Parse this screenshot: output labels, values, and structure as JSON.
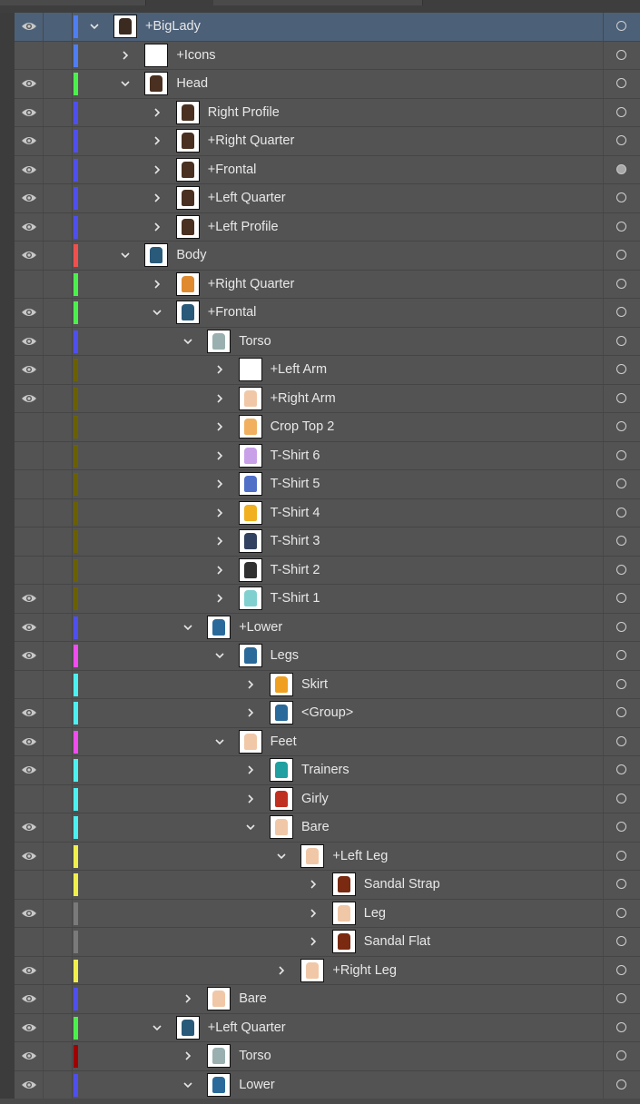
{
  "panel": "Layers",
  "colors": {
    "row_bg": "#535353",
    "selected_bg": "#4c6078",
    "blue": "#4f7ef2",
    "green": "#4cf04c",
    "violet": "#4f4ff0",
    "red": "#f0504c",
    "olive": "#6b6000",
    "magenta": "#f04cf0",
    "cyan": "#4cf0f0",
    "yellow": "#f0f04c",
    "gray": "#7a7a7a",
    "darkred": "#a00000"
  },
  "layers": [
    {
      "label": "+BigLady",
      "level": 0,
      "visible": true,
      "color": "blue",
      "expanded": true,
      "selected": true,
      "thumb": "#3a2a20"
    },
    {
      "label": "+Icons",
      "level": 1,
      "visible": false,
      "color": "blue",
      "expanded": false,
      "thumb": "#ffffff"
    },
    {
      "label": "Head",
      "level": 1,
      "visible": true,
      "color": "green",
      "expanded": true,
      "thumb": "#4a3020"
    },
    {
      "label": "Right Profile",
      "level": 2,
      "visible": true,
      "color": "violet",
      "expanded": false,
      "thumb": "#4a3020"
    },
    {
      "label": "+Right Quarter",
      "level": 2,
      "visible": true,
      "color": "violet",
      "expanded": false,
      "thumb": "#4a3020"
    },
    {
      "label": "+Frontal",
      "level": 2,
      "visible": true,
      "color": "violet",
      "expanded": false,
      "thumb": "#4a3020",
      "targeted": true
    },
    {
      "label": "+Left Quarter",
      "level": 2,
      "visible": true,
      "color": "violet",
      "expanded": false,
      "thumb": "#4a3020"
    },
    {
      "label": "+Left Profile",
      "level": 2,
      "visible": true,
      "color": "violet",
      "expanded": false,
      "thumb": "#4a3020"
    },
    {
      "label": "Body",
      "level": 1,
      "visible": true,
      "color": "red",
      "expanded": true,
      "thumb": "#2a5a7a"
    },
    {
      "label": "+Right Quarter",
      "level": 2,
      "visible": false,
      "color": "green",
      "expanded": false,
      "thumb": "#e08a30"
    },
    {
      "label": "+Frontal",
      "level": 2,
      "visible": true,
      "color": "green",
      "expanded": true,
      "thumb": "#2a5a7a"
    },
    {
      "label": "Torso",
      "level": 3,
      "visible": true,
      "color": "violet",
      "expanded": true,
      "thumb": "#9ab0b0"
    },
    {
      "label": "+Left Arm",
      "level": 4,
      "visible": true,
      "color": "olive",
      "expanded": false,
      "thumb": "#ffffff"
    },
    {
      "label": "+Right Arm",
      "level": 4,
      "visible": true,
      "color": "olive",
      "expanded": false,
      "thumb": "#f0c8a8"
    },
    {
      "label": "Crop Top 2",
      "level": 4,
      "visible": false,
      "color": "olive",
      "expanded": false,
      "thumb": "#f0b060"
    },
    {
      "label": "T-Shirt 6",
      "level": 4,
      "visible": false,
      "color": "olive",
      "expanded": false,
      "thumb": "#c8a0e8"
    },
    {
      "label": "T-Shirt 5",
      "level": 4,
      "visible": false,
      "color": "olive",
      "expanded": false,
      "thumb": "#5070c8"
    },
    {
      "label": "T-Shirt 4",
      "level": 4,
      "visible": false,
      "color": "olive",
      "expanded": false,
      "thumb": "#f0b020"
    },
    {
      "label": "T-Shirt 3",
      "level": 4,
      "visible": false,
      "color": "olive",
      "expanded": false,
      "thumb": "#304060"
    },
    {
      "label": "T-Shirt 2",
      "level": 4,
      "visible": false,
      "color": "olive",
      "expanded": false,
      "thumb": "#303030"
    },
    {
      "label": "T-Shirt 1",
      "level": 4,
      "visible": true,
      "color": "olive",
      "expanded": false,
      "thumb": "#80d0d0"
    },
    {
      "label": "+Lower",
      "level": 3,
      "visible": true,
      "color": "violet",
      "expanded": true,
      "thumb": "#2a6a9a"
    },
    {
      "label": "Legs",
      "level": 4,
      "visible": true,
      "color": "magenta",
      "expanded": true,
      "thumb": "#2a6a9a"
    },
    {
      "label": "Skirt",
      "level": 5,
      "visible": false,
      "color": "cyan",
      "expanded": false,
      "thumb": "#f0a020"
    },
    {
      "label": "<Group>",
      "level": 5,
      "visible": true,
      "color": "cyan",
      "expanded": false,
      "thumb": "#2a6a9a"
    },
    {
      "label": "Feet",
      "level": 4,
      "visible": true,
      "color": "magenta",
      "expanded": true,
      "thumb": "#f0c8a8"
    },
    {
      "label": "Trainers",
      "level": 5,
      "visible": true,
      "color": "cyan",
      "expanded": false,
      "thumb": "#20a0a0"
    },
    {
      "label": "Girly",
      "level": 5,
      "visible": false,
      "color": "cyan",
      "expanded": false,
      "thumb": "#c03020"
    },
    {
      "label": "Bare",
      "level": 5,
      "visible": true,
      "color": "cyan",
      "expanded": true,
      "thumb": "#f0c8a8"
    },
    {
      "label": "+Left Leg",
      "level": 6,
      "visible": true,
      "color": "yellow",
      "expanded": true,
      "thumb": "#f0c8a8"
    },
    {
      "label": "Sandal Strap",
      "level": 7,
      "visible": false,
      "color": "yellow",
      "expanded": false,
      "thumb": "#7a2a10"
    },
    {
      "label": "Leg",
      "level": 7,
      "visible": true,
      "color": "gray",
      "expanded": false,
      "thumb": "#f0c8a8"
    },
    {
      "label": "Sandal Flat",
      "level": 7,
      "visible": false,
      "color": "gray",
      "expanded": false,
      "thumb": "#7a2a10"
    },
    {
      "label": "+Right Leg",
      "level": 6,
      "visible": true,
      "color": "yellow",
      "expanded": false,
      "thumb": "#f0c8a8"
    },
    {
      "label": "Bare",
      "level": 3,
      "visible": true,
      "color": "violet",
      "expanded": false,
      "thumb": "#f0c8a8"
    },
    {
      "label": "+Left Quarter",
      "level": 2,
      "visible": true,
      "color": "green",
      "expanded": true,
      "thumb": "#2a5a7a"
    },
    {
      "label": "Torso",
      "level": 3,
      "visible": true,
      "color": "darkred",
      "expanded": false,
      "thumb": "#9ab0b0"
    },
    {
      "label": "Lower",
      "level": 3,
      "visible": true,
      "color": "violet",
      "expanded": true,
      "thumb": "#2a6a9a"
    }
  ]
}
